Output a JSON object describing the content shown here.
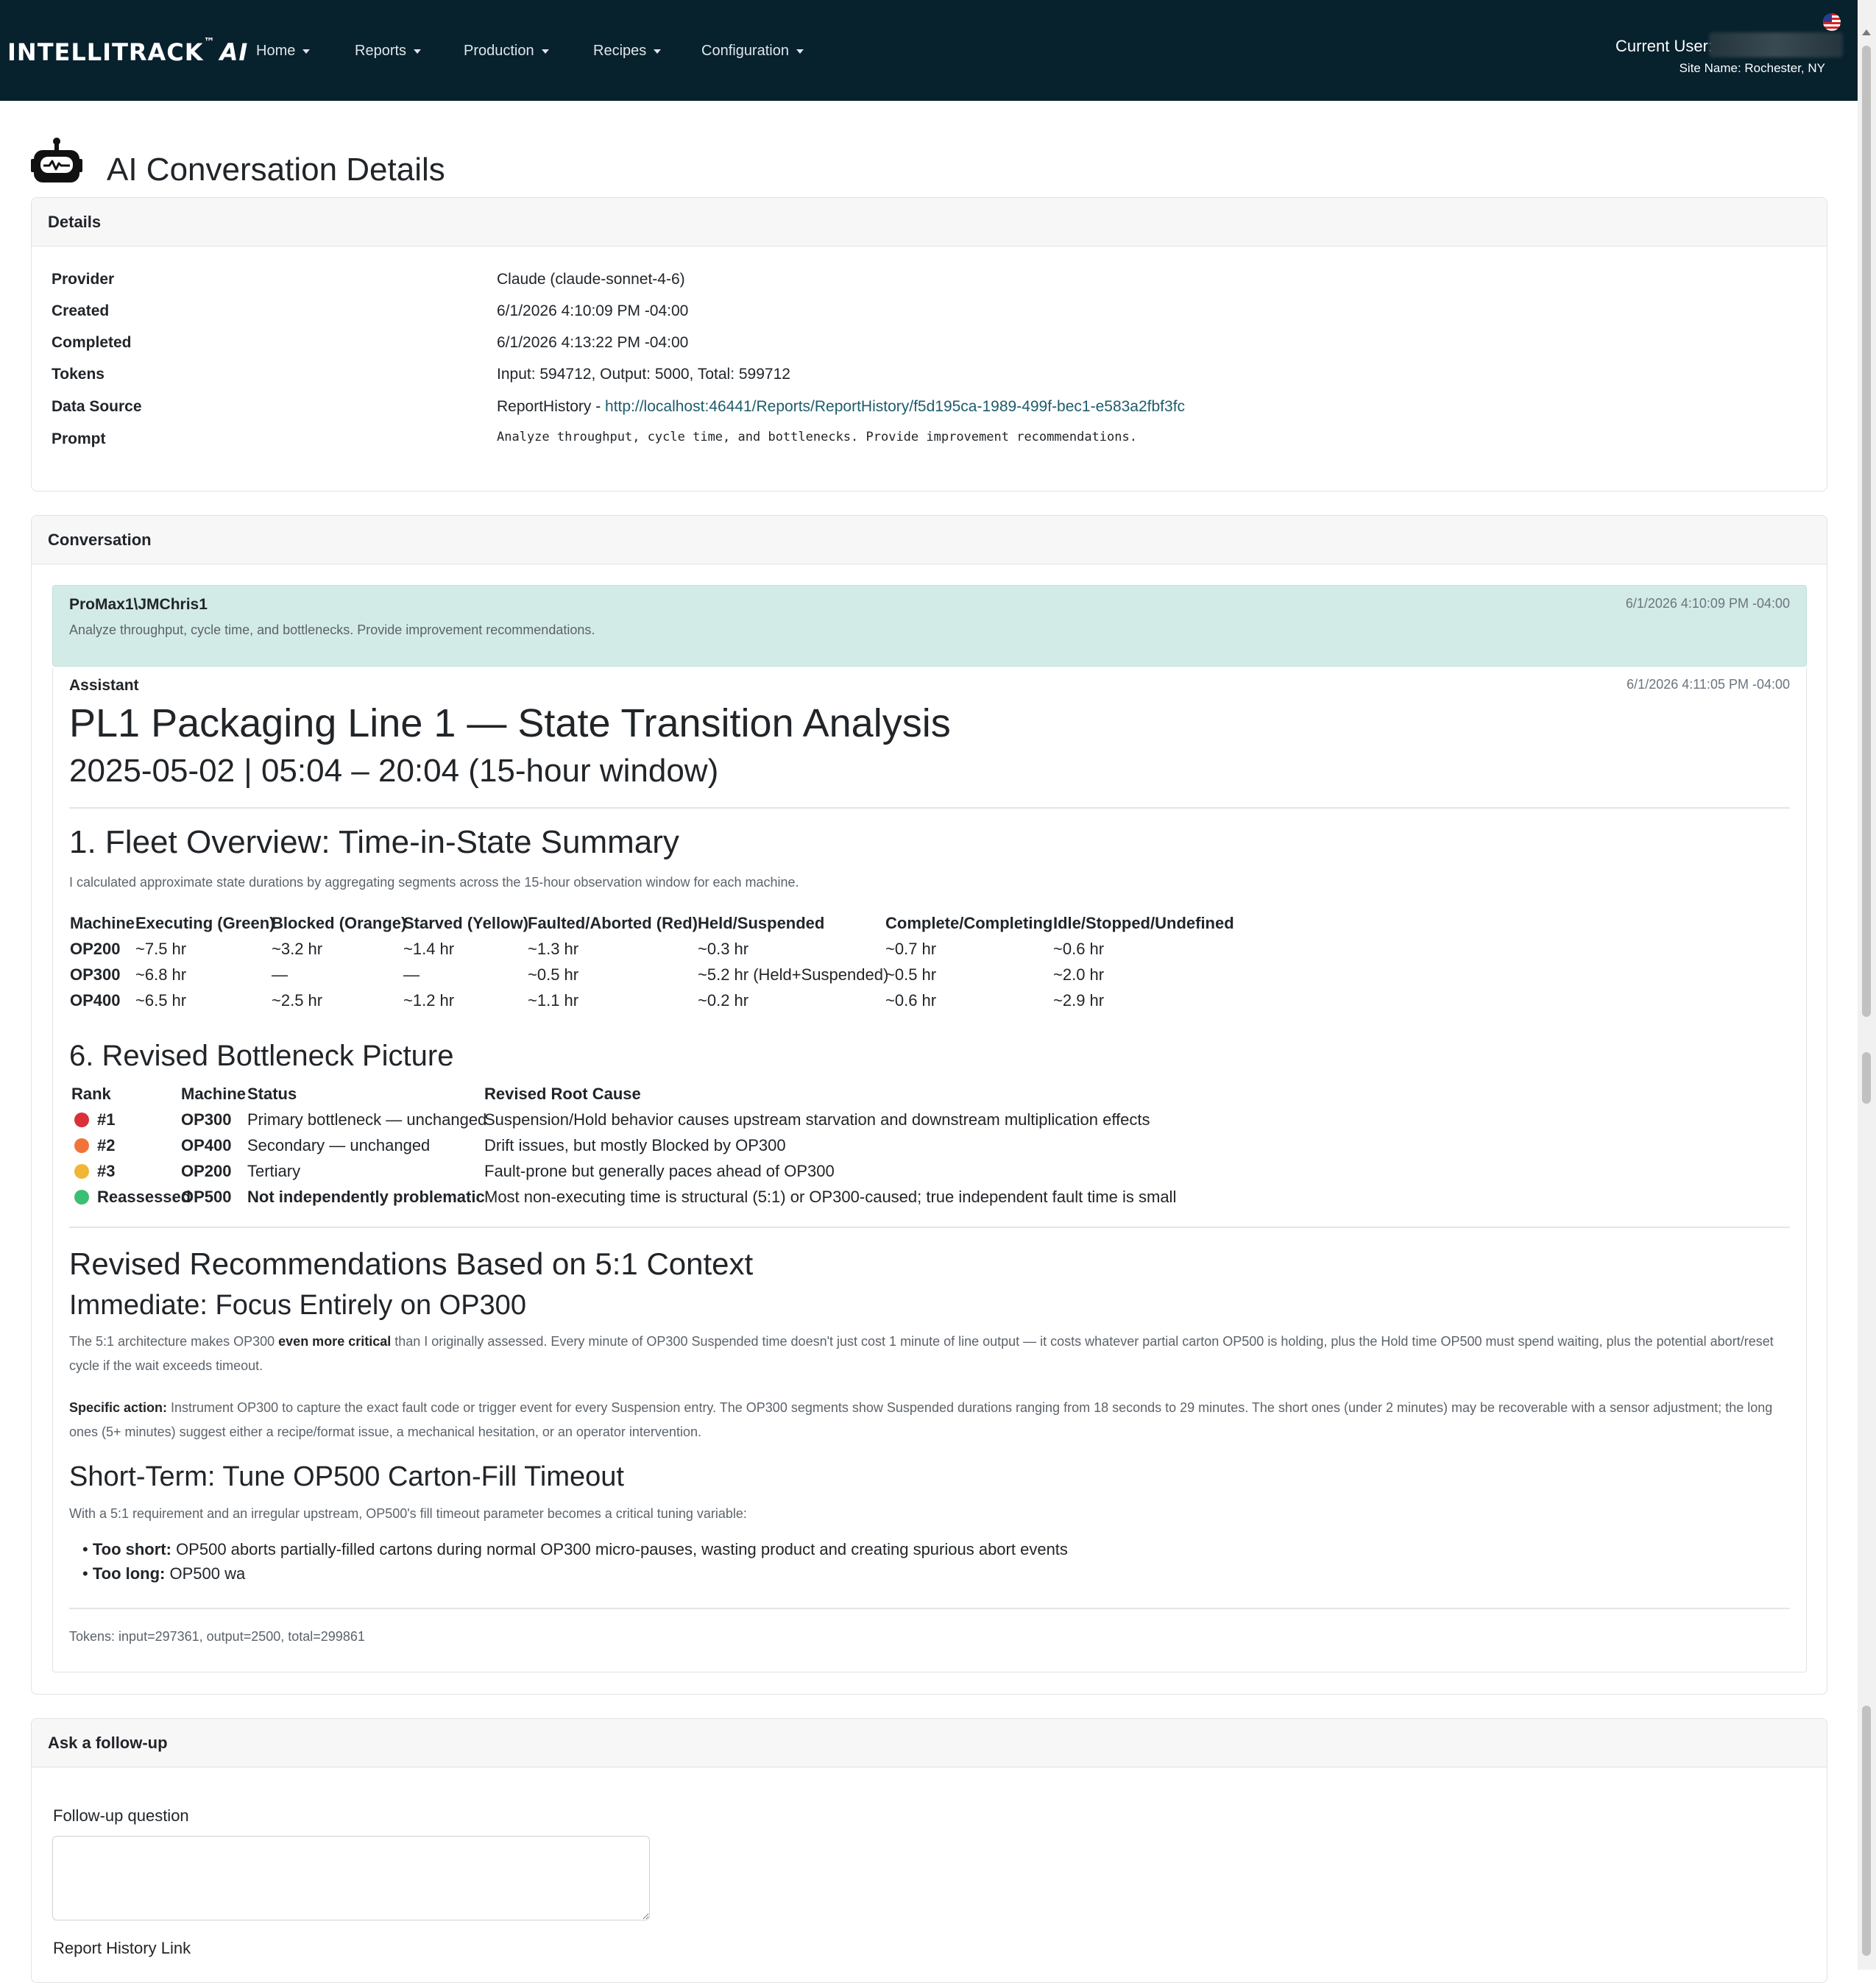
{
  "navbar": {
    "brand": "INTELLITRACK",
    "brand_tm": "™",
    "brand_ai": "AI",
    "menu": [
      "Home",
      "Reports",
      "Production",
      "Recipes",
      "Configuration"
    ],
    "current_user_label": "Current User:",
    "site_name": "Site Name: Rochester, NY"
  },
  "page": {
    "title": "AI Conversation Details"
  },
  "details": {
    "header": "Details",
    "rows": [
      {
        "key": "Provider",
        "value": "Claude (claude-sonnet-4-6)"
      },
      {
        "key": "Created",
        "value": "6/1/2026 4:10:09 PM -04:00"
      },
      {
        "key": "Completed",
        "value": "6/1/2026 4:13:22 PM -04:00"
      },
      {
        "key": "Tokens",
        "value": "Input: 594712, Output: 5000, Total: 599712"
      },
      {
        "key": "Data Source",
        "value": "ReportHistory - ",
        "link": "http://localhost:46441/Reports/ReportHistory/f5d195ca-1989-499f-bec1-e583a2fbf3fc"
      },
      {
        "key": "Prompt",
        "value": "Analyze throughput, cycle time, and bottlenecks. Provide improvement recommendations."
      }
    ]
  },
  "conversation": {
    "header": "Conversation",
    "user_message": {
      "author": "ProMax1\\JMChris1",
      "time": "6/1/2026 4:10:09 PM -04:00",
      "text": "Analyze throughput, cycle time, and bottlenecks. Provide improvement recommendations."
    },
    "assistant": {
      "author": "Assistant",
      "time": "6/1/2026 4:11:05 PM -04:00",
      "h1": "PL1 Packaging Line 1 — State Transition Analysis",
      "h1_sub": "2025-05-02 | 05:04 – 20:04 (15-hour window)",
      "section1_title": "1. Fleet Overview: Time-in-State Summary",
      "section1_intro": "I calculated approximate state durations by aggregating segments across the 15-hour observation window for each machine.",
      "state_table": {
        "headers": [
          "Machine",
          "Executing (Green)",
          "Blocked (Orange)",
          "Starved (Yellow)",
          "Faulted/Aborted (Red)",
          "Held/Suspended",
          "Complete/Completing",
          "Idle/Stopped/Undefined"
        ],
        "rows": [
          [
            "OP200",
            "~7.5 hr",
            "~3.2 hr",
            "~1.4 hr",
            "~1.3 hr",
            "~0.3 hr",
            "~0.7 hr",
            "~0.6 hr"
          ],
          [
            "OP300",
            "~6.8 hr",
            "—",
            "—",
            "~0.5 hr",
            "~5.2 hr (Held+Suspended)",
            "~0.5 hr",
            "~2.0 hr"
          ],
          [
            "OP400",
            "~6.5 hr",
            "~2.5 hr",
            "~1.2 hr",
            "~1.1 hr",
            "~0.2 hr",
            "~0.6 hr",
            "~2.9 hr"
          ]
        ]
      },
      "section6_title": "6. Revised Bottleneck Picture",
      "bottleneck_table": {
        "headers": [
          "Rank",
          "Machine",
          "Status",
          "Revised Root Cause"
        ],
        "rows": [
          {
            "rank": "#1",
            "machine": "OP300",
            "status": "Primary bottleneck — unchanged",
            "cause": "Suspension/Hold behavior causes upstream starvation and downstream multiplication effects",
            "color": "#d9303a",
            "status_bold": false
          },
          {
            "rank": "#2",
            "machine": "OP400",
            "status": "Secondary — unchanged",
            "cause": "Drift issues, but mostly Blocked by OP300",
            "color": "#f0733a",
            "status_bold": false
          },
          {
            "rank": "#3",
            "machine": "OP200",
            "status": "Tertiary",
            "cause": "Fault-prone but generally paces ahead of OP300",
            "color": "#f2b535",
            "status_bold": false
          },
          {
            "rank": "Reassessed",
            "machine": "OP500",
            "status": "Not independently problematic",
            "cause": "Most non-executing time is structural (5:1) or OP300-caused; true independent fault time is small",
            "color": "#3bbf73",
            "status_bold": true
          }
        ]
      },
      "rec_title": "Revised Recommendations Based on 5:1 Context",
      "immediate_title": "Immediate: Focus Entirely on OP300",
      "immediate_p1_a": "The 5:1 architecture makes OP300 ",
      "immediate_p1_b": "even more critical",
      "immediate_p1_c": " than I originally assessed. Every minute of OP300 Suspended time doesn't just cost 1 minute of line output — it costs whatever partial carton OP500 is holding, plus the Hold time OP500 must spend waiting, plus the potential abort/reset cycle if the wait exceeds timeout.",
      "specific_label": "Specific action:",
      "specific_text": " Instrument OP300 to capture the exact fault code or trigger event for every Suspension entry. The OP300 segments show Suspended durations ranging from 18 seconds to 29 minutes. The short ones (under 2 minutes) may be recoverable with a sensor adjustment; the long ones (5+ minutes) suggest either a recipe/format issue, a mechanical hesitation, or an operator intervention.",
      "short_term_title": "Short-Term: Tune OP500 Carton-Fill Timeout",
      "short_term_intro": "With a 5:1 requirement and an irregular upstream, OP500's fill timeout parameter becomes a critical tuning variable:",
      "bullets": [
        {
          "label": "Too short:",
          "text": " OP500 aborts partially-filled cartons during normal OP300 micro-pauses, wasting product and creating spurious abort events"
        },
        {
          "label": "Too long:",
          "text": " OP500 wa"
        }
      ],
      "tokens_footer": "Tokens: input=297361, output=2500, total=299861"
    }
  },
  "followup": {
    "header": "Ask a follow-up",
    "question_label": "Follow-up question",
    "question_value": "",
    "report_link_label": "Report History Link"
  },
  "icons": [
    "robot-icon",
    "flag-icon",
    "caret-down-icon"
  ],
  "colors": {
    "navbar": "#07212d",
    "user_message_bg": "#d3ebe7",
    "link": "#1d5c6b"
  }
}
